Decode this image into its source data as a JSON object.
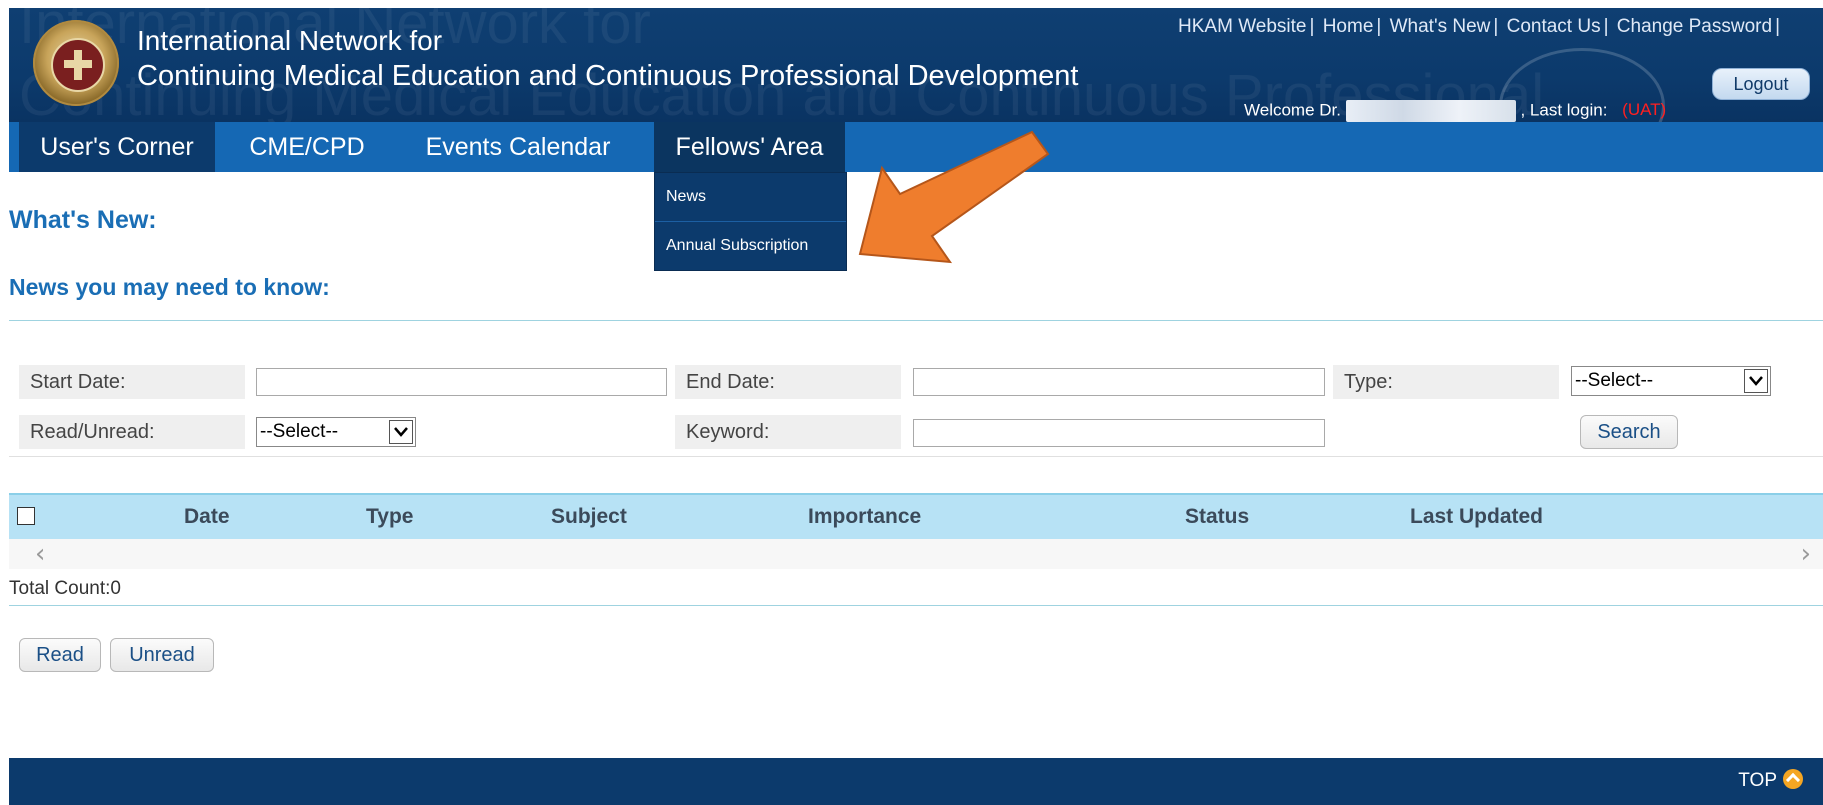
{
  "header": {
    "title_line1": "International Network for",
    "title_line2": "Continuing Medical Education and Continuous Professional Development",
    "ghost_line1": "International Network for",
    "ghost_line2": "Continuing Medical Education and Continuous Professional",
    "top_links": [
      "HKAM Website",
      "Home",
      "What's New",
      "Contact Us",
      "Change Password"
    ],
    "logout_label": "Logout",
    "welcome_prefix": "Welcome Dr.",
    "last_login_label": ", Last login:",
    "env_badge": "(UAT)"
  },
  "nav": {
    "items": [
      {
        "label": "User's Corner"
      },
      {
        "label": "CME/CPD"
      },
      {
        "label": "Events Calendar"
      },
      {
        "label": "Fellows' Area"
      }
    ],
    "dropdown": [
      "News",
      "Annual Subscription"
    ]
  },
  "content": {
    "heading": "What's New:",
    "subheading": "News you may need to know:"
  },
  "filters": {
    "start_date_label": "Start Date:",
    "end_date_label": "End Date:",
    "type_label": "Type:",
    "type_selected": "--Select--",
    "read_unread_label": "Read/Unread:",
    "read_unread_selected": "--Select--",
    "keyword_label": "Keyword:",
    "search_label": "Search"
  },
  "table": {
    "columns": [
      "Date",
      "Type",
      "Subject",
      "Importance",
      "Status",
      "Last Updated"
    ],
    "total_count": "Total Count:0"
  },
  "actions": {
    "read_label": "Read",
    "unread_label": "Unread"
  },
  "footer": {
    "top_label": "TOP"
  },
  "colors": {
    "header_bg": "#0c3a6c",
    "nav_bg": "#1568b4",
    "heading": "#1a6eb5",
    "table_head": "#b7e2f5",
    "callout_arrow": "#ef7d2d",
    "uat": "#ff2020"
  }
}
